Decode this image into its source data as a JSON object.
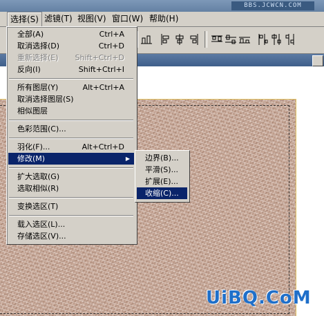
{
  "app": {
    "watermark_top": "BBS.JCWCN.COM",
    "watermark_bottom": "UiBQ.CoM"
  },
  "menubar": {
    "items": [
      {
        "label": "选择(S)"
      },
      {
        "label": "滤镜(T)"
      },
      {
        "label": "视图(V)"
      },
      {
        "label": "窗口(W)"
      },
      {
        "label": "帮助(H)"
      }
    ]
  },
  "select_menu": {
    "items": [
      {
        "label": "全部(A)",
        "shortcut": "Ctrl+A",
        "enabled": true
      },
      {
        "label": "取消选择(D)",
        "shortcut": "Ctrl+D",
        "enabled": true
      },
      {
        "label": "重新选择(E)",
        "shortcut": "Shift+Ctrl+D",
        "enabled": false
      },
      {
        "label": "反向(I)",
        "shortcut": "Shift+Ctrl+I",
        "enabled": true
      },
      {
        "label": "所有图层(Y)",
        "shortcut": "Alt+Ctrl+A",
        "enabled": true
      },
      {
        "label": "取消选择图层(S)",
        "shortcut": "",
        "enabled": true
      },
      {
        "label": "相似图层",
        "shortcut": "",
        "enabled": true
      },
      {
        "label": "色彩范围(C)...",
        "shortcut": "",
        "enabled": true
      },
      {
        "label": "羽化(F)...",
        "shortcut": "Alt+Ctrl+D",
        "enabled": true
      },
      {
        "label": "修改(M)",
        "shortcut": "",
        "enabled": true,
        "submenu": true
      },
      {
        "label": "扩大选取(G)",
        "shortcut": "",
        "enabled": true
      },
      {
        "label": "选取相似(R)",
        "shortcut": "",
        "enabled": true
      },
      {
        "label": "变换选区(T)",
        "shortcut": "",
        "enabled": true
      },
      {
        "label": "载入选区(L)...",
        "shortcut": "",
        "enabled": true
      },
      {
        "label": "存储选区(V)...",
        "shortcut": "",
        "enabled": true
      }
    ]
  },
  "modify_submenu": {
    "items": [
      {
        "label": "边界(B)..."
      },
      {
        "label": "平滑(S)..."
      },
      {
        "label": "扩展(E)..."
      },
      {
        "label": "收缩(C)..."
      }
    ]
  },
  "colors": {
    "highlight": "#0a246a",
    "menu_bg": "#d4d0c8",
    "canvas": "#c9aa9a"
  }
}
